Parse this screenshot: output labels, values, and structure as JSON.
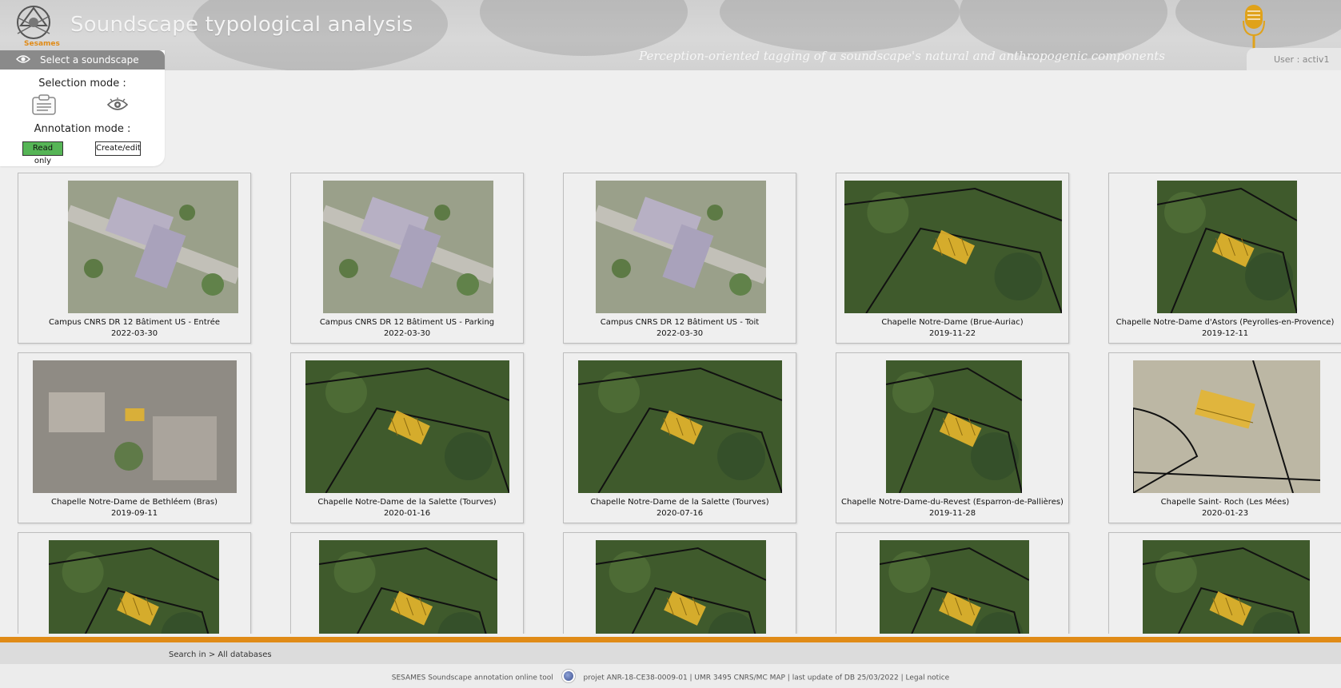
{
  "header": {
    "logo_text": "Sesames",
    "title": "Soundscape typological analysis",
    "subtitle": "Perception-oriented tagging of a soundscape's natural and anthropogenic components",
    "user_label": "User : activ1"
  },
  "panel": {
    "title": "Select a soundscape",
    "selection_mode_label": "Selection mode :",
    "annotation_mode_label": "Annotation mode :",
    "read_only_label": "Read only",
    "create_edit_label": "Create/edit"
  },
  "soundscapes": [
    {
      "name": "Campus CNRS DR 12 Bâtiment US - Entrée",
      "date": "2022-03-30"
    },
    {
      "name": "Campus CNRS DR 12 Bâtiment US - Parking",
      "date": "2022-03-30"
    },
    {
      "name": "Campus CNRS DR 12 Bâtiment US - Toit",
      "date": "2022-03-30"
    },
    {
      "name": "Chapelle Notre-Dame (Brue-Auriac)",
      "date": "2019-11-22"
    },
    {
      "name": "Chapelle Notre-Dame d'Astors (Peyrolles-en-Provence)",
      "date": "2019-12-11"
    },
    {
      "name": "Chapelle Notre-Dame de Bethléem (Bras)",
      "date": "2019-09-11"
    },
    {
      "name": "Chapelle Notre-Dame de la Salette (Tourves)",
      "date": "2020-01-16"
    },
    {
      "name": "Chapelle Notre-Dame de la Salette (Tourves)",
      "date": "2020-07-16"
    },
    {
      "name": "Chapelle Notre-Dame-du-Revest (Esparron-de-Pallières)",
      "date": "2019-11-28"
    },
    {
      "name": "Chapelle Saint- Roch (Les Mées)",
      "date": "2020-01-23"
    },
    {
      "name": "",
      "date": ""
    },
    {
      "name": "",
      "date": ""
    },
    {
      "name": "",
      "date": ""
    },
    {
      "name": "",
      "date": ""
    },
    {
      "name": "",
      "date": ""
    }
  ],
  "search": {
    "prefix": "Search in >",
    "scope": "All databases"
  },
  "footer": {
    "tool_name": "SESAMES Soundscape annotation online tool",
    "info": "projet ANR-18-CE38-0009-01 | UMR 3495 CNRS/MC MAP | last update of DB 25/03/2022 | Legal notice"
  },
  "colors": {
    "accent_orange": "#e08b17",
    "read_only_green": "#56b556",
    "panel_header_gray": "#8a8a8a"
  }
}
